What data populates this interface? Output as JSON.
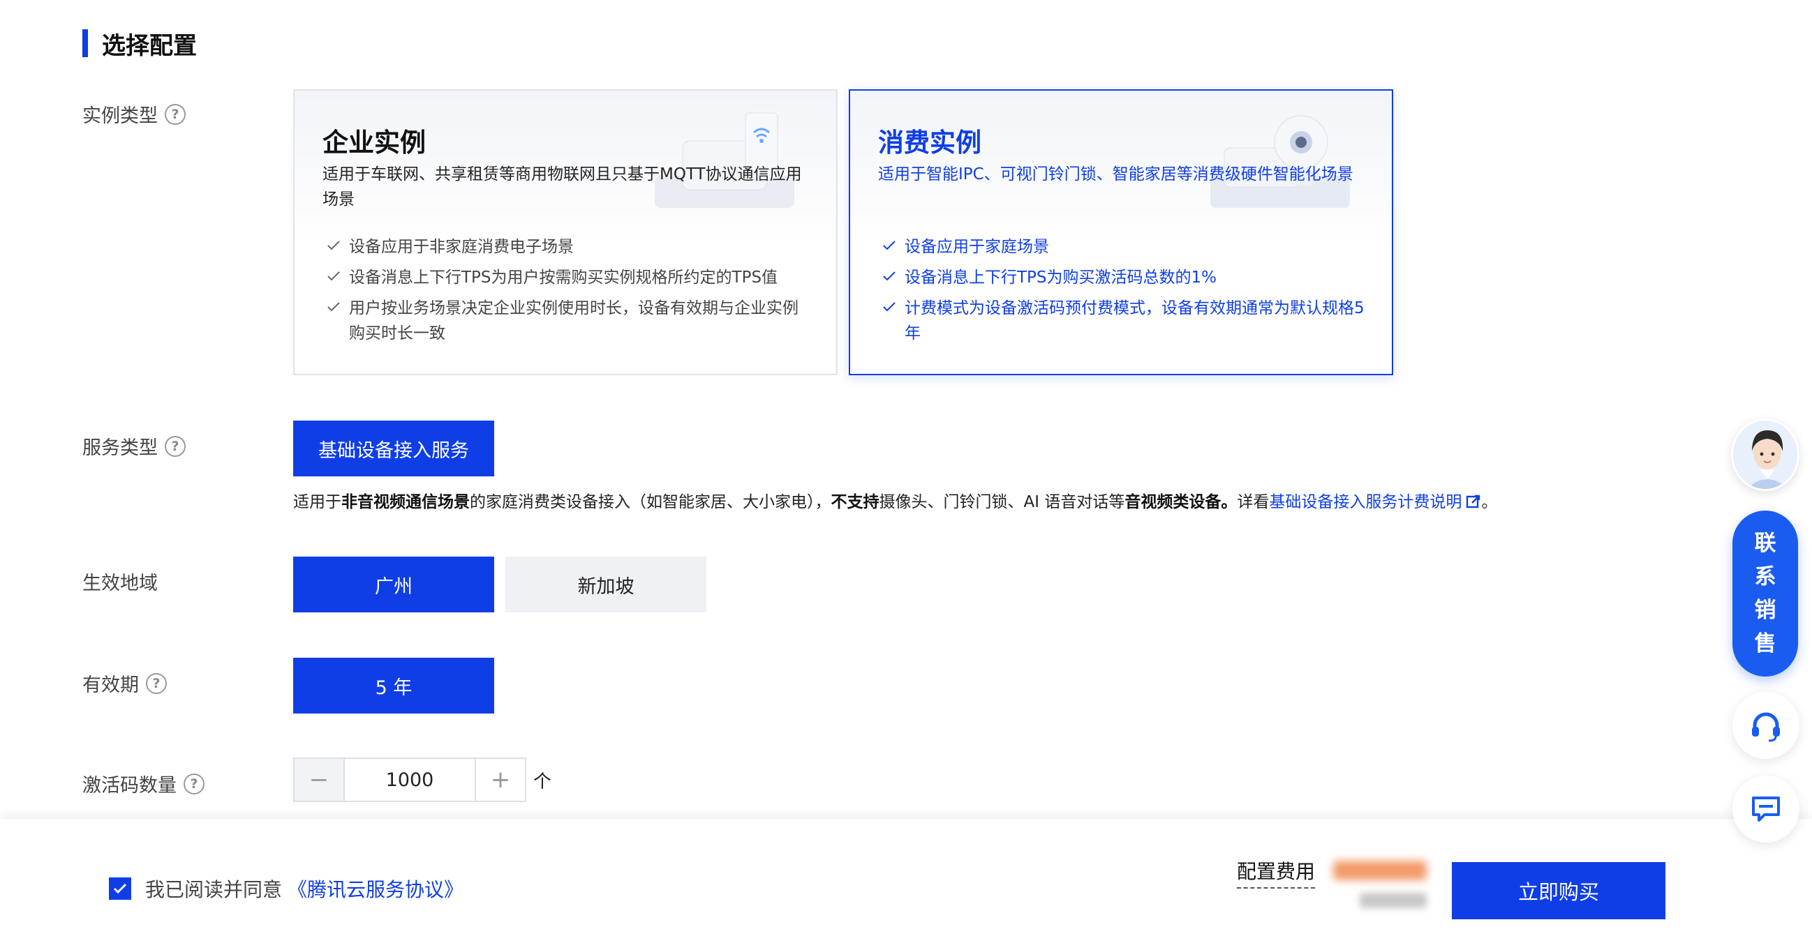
{
  "section": {
    "title": "选择配置"
  },
  "labels": {
    "instance_type": "实例类型",
    "service_type": "服务类型",
    "region": "生效地域",
    "validity": "有效期",
    "code_count": "激活码数量"
  },
  "help_glyph": "?",
  "cards": [
    {
      "title": "企业实例",
      "desc": "适用于车联网、共享租赁等商用物联网且只基于MQTT协议通信应用场景",
      "items": [
        "设备应用于非家庭消费电子场景",
        "设备消息上下行TPS为用户按需购买实例规格所约定的TPS值",
        "用户按业务场景决定企业实例使用时长，设备有效期与企业实例购买时长一致"
      ],
      "selected": false
    },
    {
      "title": "消费实例",
      "desc": "适用于智能IPC、可视门铃门锁、智能家居等消费级硬件智能化场景",
      "items": [
        "设备应用于家庭场景",
        "设备消息上下行TPS为购买激活码总数的1%",
        "计费模式为设备激活码预付费模式，设备有效期通常为默认规格5年"
      ],
      "selected": true
    }
  ],
  "service": {
    "button": "基础设备接入服务",
    "note_1": "适用于",
    "note_b1": "非音视频通信场景",
    "note_2": "的家庭消费类设备接入（如智能家居、大小家电），",
    "note_b2": "不支持",
    "note_3": "摄像头、门铃门锁、AI 语音对话等",
    "note_b3": "音视频类设备。",
    "note_4": "详看",
    "note_link": "基础设备接入服务计费说明",
    "note_end": "。"
  },
  "regions": {
    "selected": "广州",
    "other": "新加坡"
  },
  "validity": {
    "value": "5 年"
  },
  "stepper": {
    "minus": "−",
    "value": "1000",
    "plus": "+",
    "unit": "个"
  },
  "bottom": {
    "agree_text": "我已阅读并同意",
    "agree_link": "《腾讯云服务协议》",
    "fee_label": "配置费用",
    "buy_button": "立即购买"
  },
  "float": {
    "contact_chars": [
      "联",
      "系",
      "销",
      "售"
    ],
    "support_icon": "headset-icon",
    "feedback_icon": "feedback-icon"
  },
  "colors": {
    "primary": "#0f3ee6",
    "contact": "#1a5cf0"
  }
}
